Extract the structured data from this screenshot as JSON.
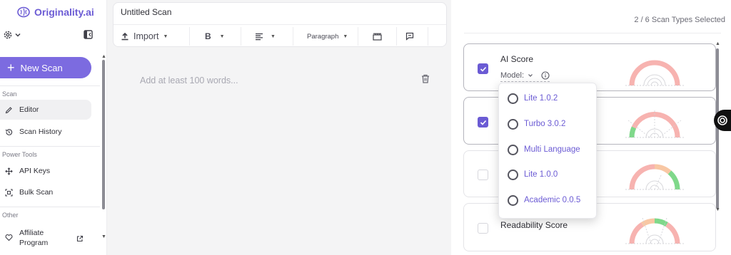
{
  "app": {
    "logo_text": "Originality.ai"
  },
  "sidebar": {
    "new_scan_label": "New Scan",
    "sections": [
      {
        "label": "Scan",
        "items": [
          {
            "label": "Editor",
            "icon": "pencil-icon",
            "active": true
          },
          {
            "label": "Scan History",
            "icon": "history-icon"
          }
        ]
      },
      {
        "label": "Power Tools",
        "items": [
          {
            "label": "API Keys",
            "icon": "api-keys-icon"
          },
          {
            "label": "Bulk Scan",
            "icon": "bulk-scan-icon"
          }
        ]
      },
      {
        "label": "Other",
        "items": [
          {
            "label": "Affiliate Program",
            "icon": "heart-icon"
          }
        ]
      }
    ]
  },
  "editor": {
    "title": "Untitled Scan",
    "toolbar": {
      "import_label": "Import",
      "bold_label": "B",
      "paragraph_label": "Paragraph"
    },
    "placeholder": "Add at least 100 words..."
  },
  "scan_panel": {
    "selected_text": "2 / 6 Scan Types Selected",
    "cards": [
      {
        "title": "AI Score",
        "checked": true,
        "model_label": "Model:"
      },
      {
        "title": "",
        "checked": true
      },
      {
        "title": "",
        "checked": false
      },
      {
        "title": "Readability Score",
        "checked": false
      }
    ]
  },
  "model_dropdown": {
    "options": [
      "Lite 1.0.2",
      "Turbo 3.0.2",
      "Multi Language",
      "Lite 1.0.0",
      "Academic 0.0.5"
    ]
  },
  "colors": {
    "accent": "#6b5bd4",
    "button": "#7c6be0",
    "gauge_red": "#f7b3b0",
    "gauge_green": "#7fd88a",
    "gauge_orange": "#f8c7a4"
  }
}
